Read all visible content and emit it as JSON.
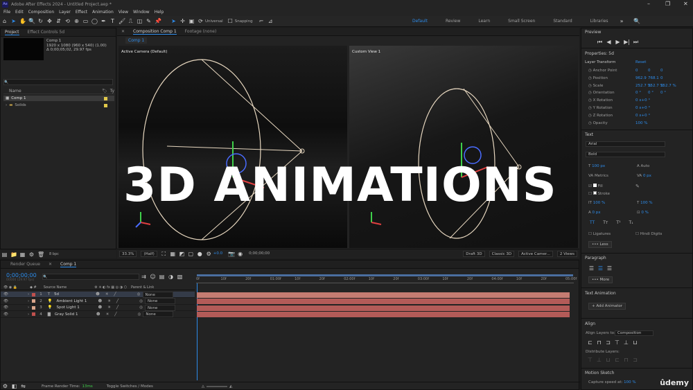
{
  "window": {
    "app_badge": "Ae",
    "title": "Adobe After Effects 2024 - Untitled Project.aep *"
  },
  "menu": [
    "File",
    "Edit",
    "Composition",
    "Layer",
    "Effect",
    "Animation",
    "View",
    "Window",
    "Help"
  ],
  "toolbar": {
    "universal": "Universal",
    "snapping": "Snapping",
    "workspaces": [
      "Default",
      "Review",
      "Learn",
      "Small Screen",
      "Standard",
      "Libraries"
    ],
    "active_workspace": "Default"
  },
  "project_panel": {
    "tabs": [
      "Project",
      "Effect Controls 5d"
    ],
    "selected_item": "Comp 1",
    "item_info": [
      "1920 x 1080 (960 x 540) (1.00)",
      "Δ 0;00;05;02, 29.97 fps"
    ],
    "column_name": "Name",
    "column_type": "Ty",
    "items": [
      {
        "name": "Comp 1",
        "selected": true,
        "color": "#e0c84a"
      },
      {
        "name": "Solids",
        "selected": false,
        "color": "#e0c84a"
      }
    ],
    "bpc": "8 bpc"
  },
  "composition_panel": {
    "tabs": [
      "Composition Comp 1",
      "Footage (none)"
    ],
    "comp_tab": "Comp 1",
    "view_left": "Active Camera (Default)",
    "view_right": "Custom View 1",
    "zoom": "33.3%",
    "resolution": "(Half)",
    "exposure": "+0.0",
    "timecode": "0;00;00;00",
    "renderer_label": "Draft 3D",
    "renderer": "Classic 3D",
    "camera": "Active Camer...",
    "views": "2 Views"
  },
  "overlay_text": "3D ANIMATIONS",
  "timeline": {
    "tabs": [
      "Render Queue",
      "Comp 1"
    ],
    "timecode": "0;00;00;00",
    "fps_sub": "00000 (29.97 fps)",
    "col_source_name": "Source Name",
    "col_parent": "Parent & Link",
    "ruler_ticks": [
      "0f",
      "10f",
      "20f",
      "01:00f",
      "10f",
      "20f",
      "02:00f",
      "10f",
      "20f",
      "03:00f",
      "10f",
      "20f",
      "04:00f",
      "10f",
      "20f",
      "05:00f"
    ],
    "layers": [
      {
        "num": "1",
        "name": "5d",
        "type": "T",
        "parent": "None",
        "color": "#c0504d",
        "selected": true
      },
      {
        "num": "2",
        "name": "Ambient Light 1",
        "type": "💡",
        "parent": "None",
        "color": "#d9a58a",
        "selected": false
      },
      {
        "num": "3",
        "name": "Spot Light 1",
        "type": "💡",
        "parent": "None",
        "color": "#d9a58a",
        "selected": false
      },
      {
        "num": "4",
        "name": "Gray Solid 1",
        "type": "▇",
        "parent": "None",
        "color": "#c0504d",
        "selected": false
      }
    ],
    "frame_render_label": "Frame Render Time:",
    "frame_render_value": "13ms",
    "toggle_label": "Toggle Switches / Modes"
  },
  "preview": {
    "title": "Preview"
  },
  "properties": {
    "title": "Properties: 5d",
    "layer_transform": "Layer Transform",
    "reset": "Reset",
    "rows": [
      {
        "label": "Anchor Point",
        "v": [
          "0",
          "0",
          "0"
        ]
      },
      {
        "label": "Position",
        "v": [
          "962.9",
          "768.1",
          "0"
        ]
      },
      {
        "label": "Scale",
        "v": [
          "252.7 %",
          "252.7 %",
          "252.7 %"
        ]
      },
      {
        "label": "Orientation",
        "v": [
          "0 °",
          "0 °",
          "0 °"
        ]
      },
      {
        "label": "X Rotation",
        "v": [
          "0 x+0 °"
        ]
      },
      {
        "label": "Y Rotation",
        "v": [
          "0 x+0 °"
        ]
      },
      {
        "label": "Z Rotation",
        "v": [
          "0 x+0 °"
        ]
      },
      {
        "label": "Opacity",
        "v": [
          "100 %"
        ]
      }
    ]
  },
  "text_panel": {
    "title": "Text",
    "font": "Arial",
    "style": "Bold",
    "size": "100 px",
    "leading": "Auto",
    "tracking": "0 px",
    "kerning": "Metrics",
    "fill_label": "Fill",
    "stroke_label": "Stroke",
    "vscale": "100 %",
    "hscale": "100 %",
    "baseline": "0 px",
    "tsume": "0 %",
    "ligatures": "Ligatures",
    "hindi_digits": "Hindi Digits",
    "less": "Less"
  },
  "paragraph_panel": {
    "title": "Paragraph",
    "more": "More"
  },
  "text_animation": {
    "title": "Text Animation",
    "add_animator": "Add Animator"
  },
  "align_panel": {
    "title": "Align",
    "align_to_label": "Align Layers to:",
    "align_to": "Composition",
    "distribute": "Distribute Layers:"
  },
  "motion_sketch": {
    "title": "Motion Sketch",
    "capture_label": "Capture speed at:",
    "capture_value": "100 %"
  },
  "watermark": "ûdemy"
}
